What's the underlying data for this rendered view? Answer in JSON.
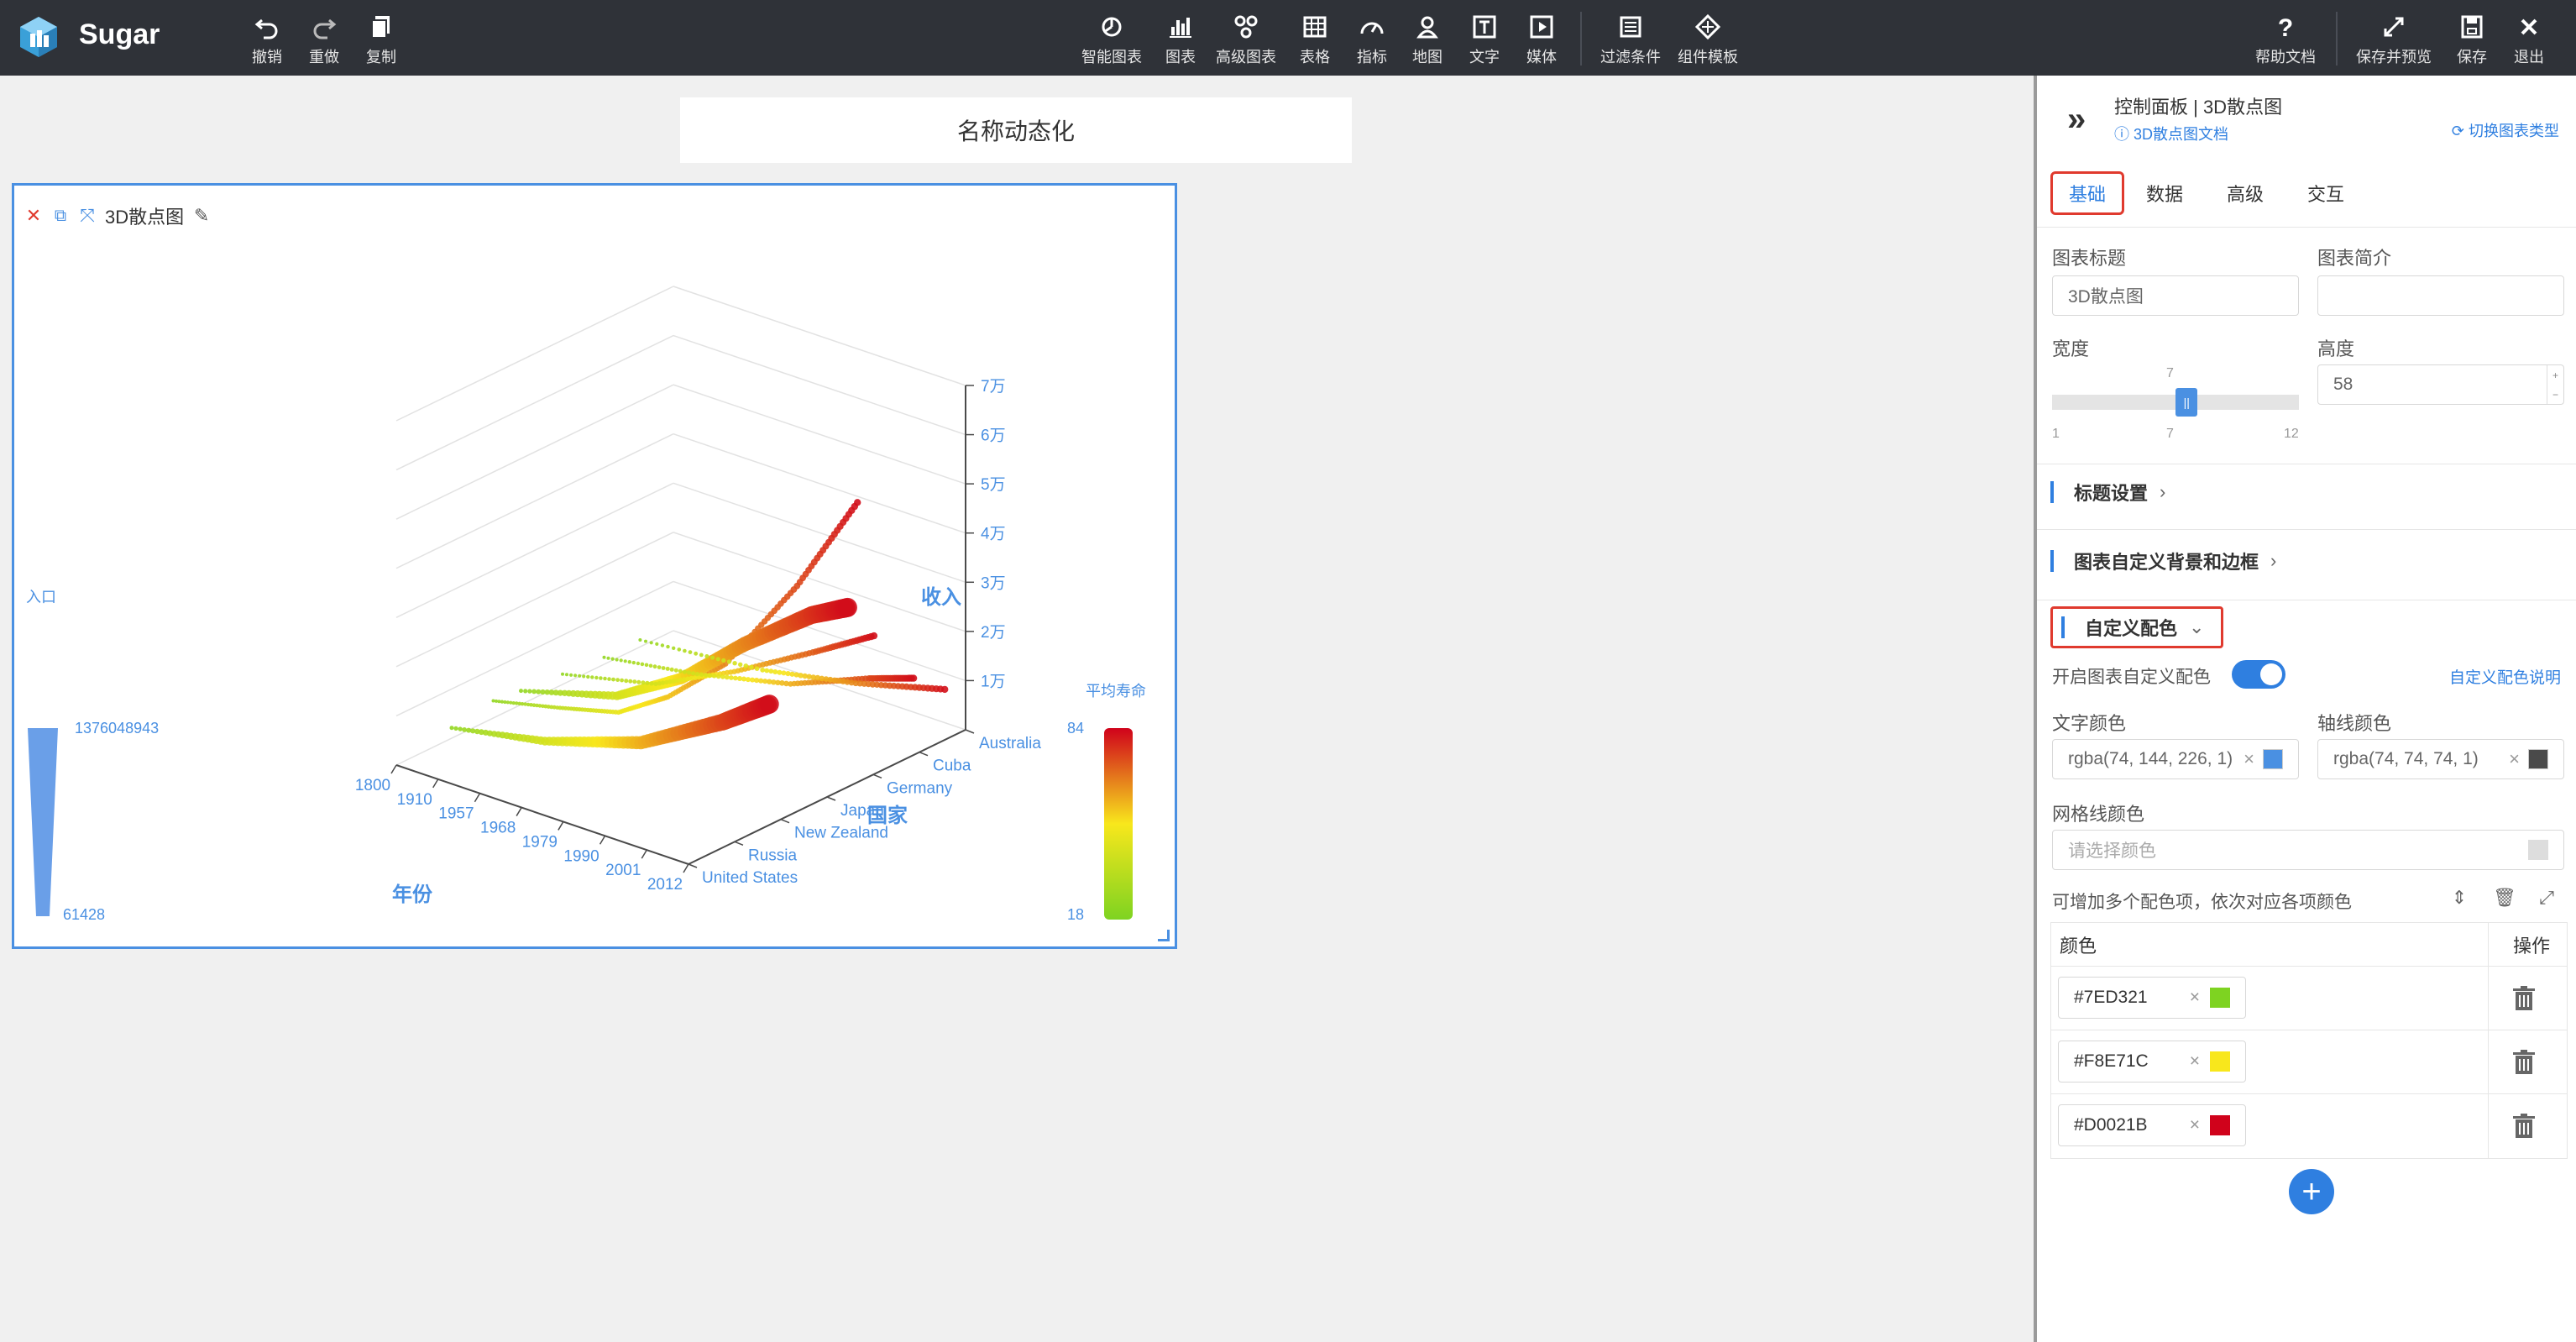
{
  "app": {
    "name": "Sugar"
  },
  "toolbar": {
    "undo": "撤销",
    "redo": "重做",
    "copy": "复制",
    "smart_chart": "智能图表",
    "chart": "图表",
    "advanced_chart": "高级图表",
    "table": "表格",
    "indicator": "指标",
    "map": "地图",
    "text": "文字",
    "media": "媒体",
    "filter": "过滤条件",
    "template": "组件模板",
    "help": "帮助文档",
    "save_preview": "保存并预览",
    "save": "保存",
    "exit": "退出"
  },
  "canvas": {
    "page_title": "名称动态化",
    "chart_title": "3D散点图"
  },
  "chart_data": {
    "type": "scatter",
    "title": "",
    "axes": {
      "x_label": "年份",
      "x_ticks": [
        "1800",
        "1910",
        "1957",
        "1968",
        "1979",
        "1990",
        "2001",
        "2012"
      ],
      "y_label": "国家",
      "y_ticks": [
        "United States",
        "Russia",
        "New Zealand",
        "Japan",
        "Germany",
        "Cuba",
        "Australia"
      ],
      "z_label": "收入",
      "z_ticks": [
        "1万",
        "2万",
        "3万",
        "4万",
        "5万",
        "6万",
        "7万"
      ]
    },
    "size_legend": {
      "label": "入口",
      "max": "1376048943",
      "min": "61428"
    },
    "color_legend": {
      "label": "平均寿命",
      "max": "84",
      "min": "18",
      "colors": [
        "#D0021B",
        "#F8E71C",
        "#7ED321"
      ]
    },
    "series": [
      {
        "values": [
          [
            0,
            0.35,
            0.05
          ],
          [
            0.2,
            0.37,
            0.08
          ],
          [
            0.4,
            0.38,
            0.12
          ],
          [
            0.55,
            0.4,
            0.2
          ],
          [
            0.7,
            0.45,
            0.32
          ],
          [
            0.85,
            0.55,
            0.55
          ],
          [
            1,
            0.62,
            0.82
          ]
        ]
      },
      {
        "values": [
          [
            0,
            0.45,
            0.04
          ],
          [
            0.3,
            0.48,
            0.1
          ],
          [
            0.5,
            0.5,
            0.2
          ],
          [
            0.7,
            0.52,
            0.35
          ],
          [
            0.9,
            0.55,
            0.48
          ],
          [
            1,
            0.58,
            0.52
          ]
        ]
      },
      {
        "values": [
          [
            0,
            0.6,
            0.03
          ],
          [
            0.3,
            0.62,
            0.08
          ],
          [
            0.55,
            0.64,
            0.18
          ],
          [
            0.8,
            0.66,
            0.3
          ],
          [
            1,
            0.68,
            0.4
          ]
        ]
      },
      {
        "values": [
          [
            0,
            0.2,
            0.03
          ],
          [
            0.3,
            0.22,
            0.07
          ],
          [
            0.6,
            0.25,
            0.14
          ],
          [
            0.85,
            0.28,
            0.26
          ],
          [
            1,
            0.3,
            0.35
          ]
        ]
      },
      {
        "values": [
          [
            0,
            0.75,
            0.02
          ],
          [
            0.3,
            0.77,
            0.05
          ],
          [
            0.6,
            0.79,
            0.1
          ],
          [
            0.85,
            0.81,
            0.18
          ],
          [
            1,
            0.82,
            0.22
          ]
        ]
      },
      {
        "values": [
          [
            0,
            0.88,
            0.02
          ],
          [
            0.4,
            0.9,
            0.04
          ],
          [
            0.7,
            0.92,
            0.08
          ],
          [
            1,
            0.94,
            0.14
          ]
        ]
      }
    ]
  },
  "panel": {
    "breadcrumb": "控制面板 | 3D散点图",
    "doc_link": "3D散点图文档",
    "switch_type": "切换图表类型",
    "tabs": [
      "基础",
      "数据",
      "高级",
      "交互"
    ],
    "chart_title_label": "图表标题",
    "chart_title_value": "3D散点图",
    "chart_desc_label": "图表简介",
    "chart_desc_value": "",
    "width_label": "宽度",
    "width_value": "7",
    "width_min": "1",
    "width_max": "12",
    "width_fraction": 0.545,
    "height_label": "高度",
    "height_value": "58",
    "sections": {
      "title_settings": "标题设置",
      "bg_border": "图表自定义背景和边框",
      "custom_colors": "自定义配色"
    },
    "enable_custom_colors": "开启图表自定义配色",
    "custom_colors_help": "自定义配色说明",
    "text_color_label": "文字颜色",
    "text_color_value": "rgba(74, 144, 226, 1)",
    "text_color_swatch": "#4a90e2",
    "axis_color_label": "轴线颜色",
    "axis_color_value": "rgba(74, 74, 74, 1)",
    "axis_color_swatch": "#4a4a4a",
    "grid_color_label": "网格线颜色",
    "grid_color_placeholder": "请选择颜色",
    "multi_color_hint": "可增加多个配色项，依次对应各项颜色",
    "table": {
      "col_color": "颜色",
      "col_action": "操作",
      "rows": [
        {
          "value": "#7ED321",
          "swatch": "#7ED321"
        },
        {
          "value": "#F8E71C",
          "swatch": "#F8E71C"
        },
        {
          "value": "#D0021B",
          "swatch": "#D0021B"
        }
      ]
    }
  }
}
